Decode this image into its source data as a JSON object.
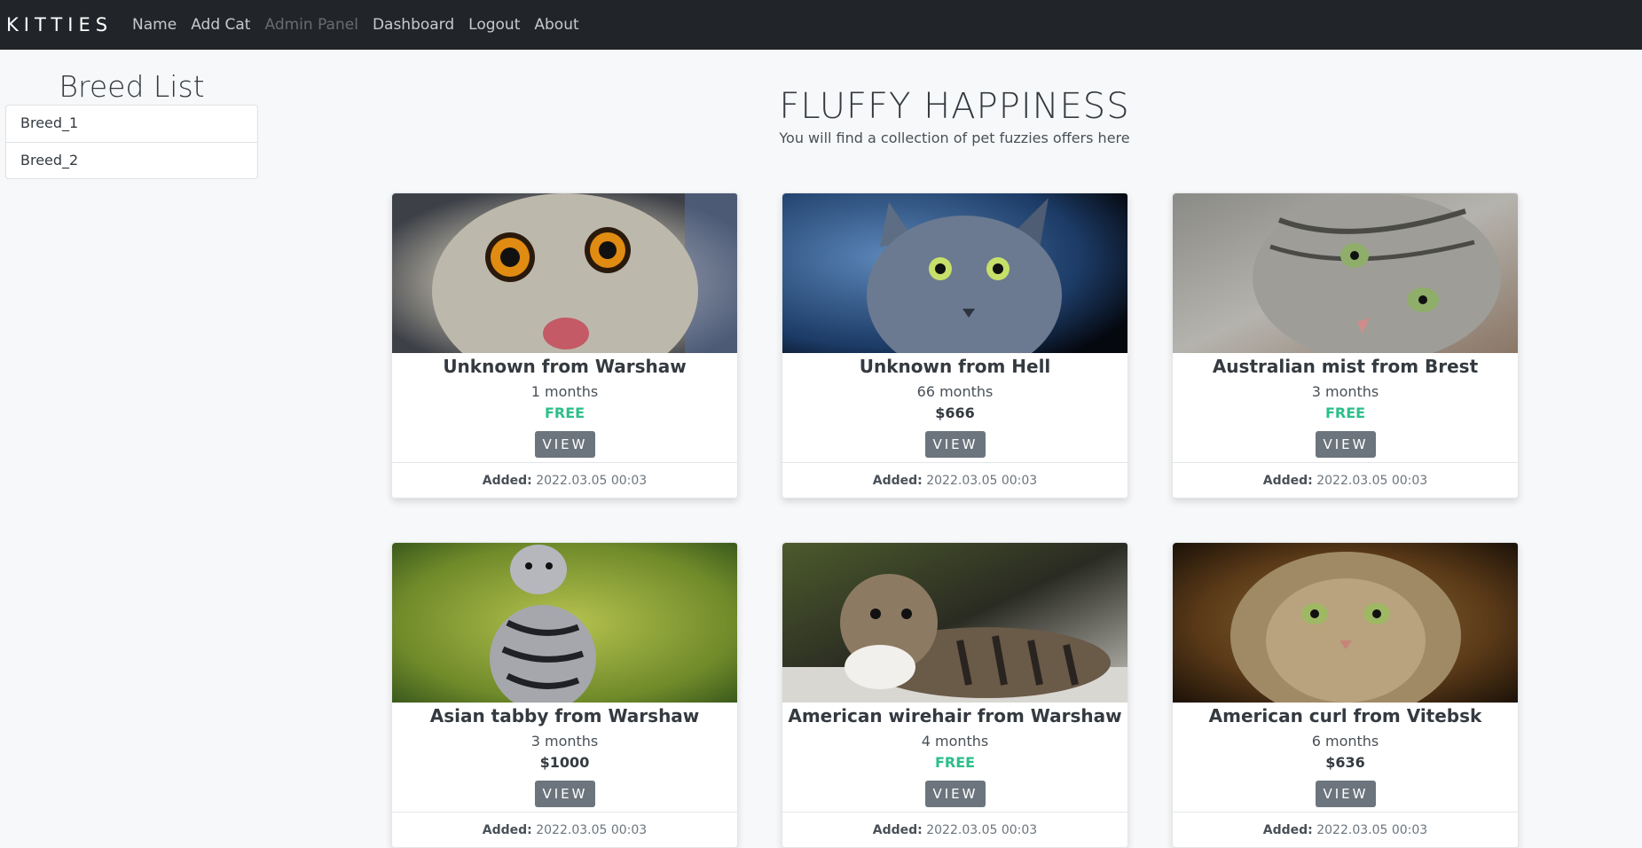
{
  "nav": {
    "brand": "KITTIES",
    "links": [
      "Name",
      "Add Cat",
      "Admin Panel",
      "Dashboard",
      "Logout",
      "About"
    ]
  },
  "sidebar": {
    "title": "Breed List",
    "items": [
      "Breed_1",
      "Breed_2"
    ]
  },
  "hero": {
    "title": "FLUFFY HAPPINESS",
    "subtitle": "You will find a collection of pet fuzzies offers here"
  },
  "cards": [
    {
      "title": "Unknown from Warshaw",
      "age": "1 months",
      "price": "FREE",
      "button": "VIEW",
      "added_label": "Added:",
      "added": "2022.03.05 00:03"
    },
    {
      "title": "Unknown from Hell",
      "age": "66 months",
      "price": "$666",
      "button": "VIEW",
      "added_label": "Added:",
      "added": "2022.03.05 00:03"
    },
    {
      "title": "Australian mist from Brest",
      "age": "3 months",
      "price": "FREE",
      "button": "VIEW",
      "added_label": "Added:",
      "added": "2022.03.05 00:03"
    },
    {
      "title": "Asian tabby from Warshaw",
      "age": "3 months",
      "price": "$1000",
      "button": "VIEW",
      "added_label": "Added:",
      "added": "2022.03.05 00:03"
    },
    {
      "title": "American wirehair from Warshaw",
      "age": "4 months",
      "price": "FREE",
      "button": "VIEW",
      "added_label": "Added:",
      "added": "2022.03.05 00:03"
    },
    {
      "title": "American curl from Vitebsk",
      "age": "6 months",
      "price": "$636",
      "button": "VIEW",
      "added_label": "Added:",
      "added": "2022.03.05 00:03"
    }
  ],
  "colors": {
    "navbar": "#212529",
    "free_price": "#2bbf8a",
    "view_button": "#6c757d"
  }
}
